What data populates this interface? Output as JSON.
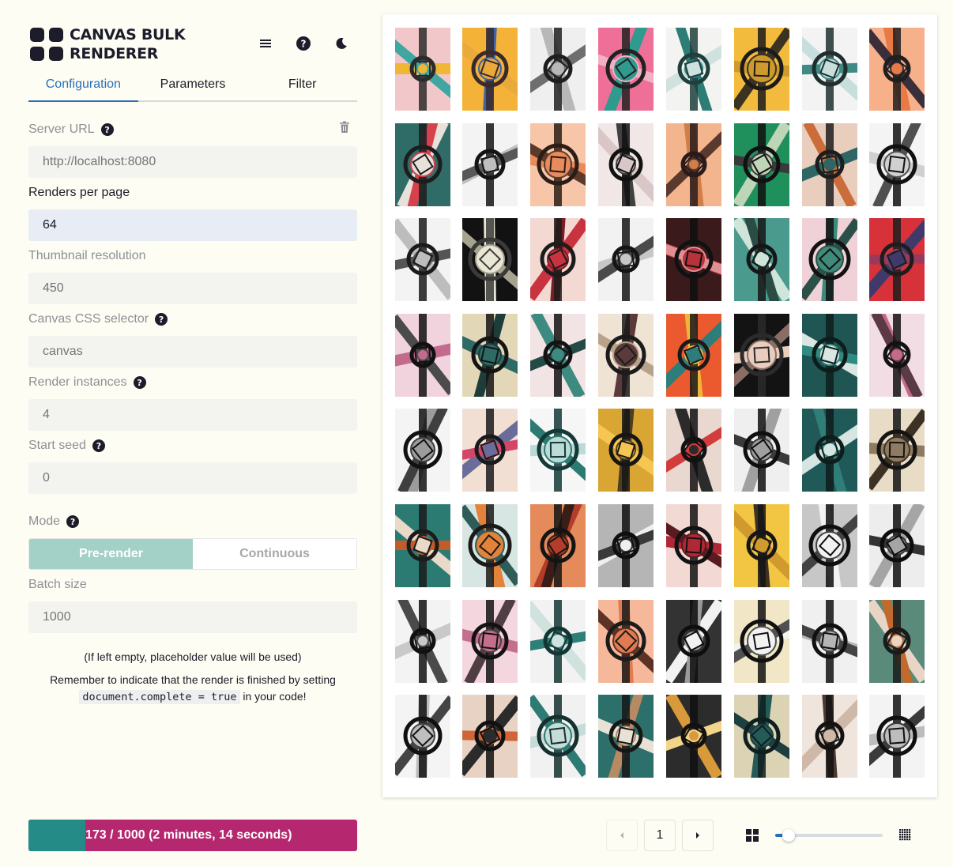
{
  "app": {
    "title_line1": "CANVAS BULK",
    "title_line2": "RENDERER",
    "header_icons": [
      "menu-icon",
      "help-icon",
      "dark-mode-icon"
    ]
  },
  "tabs": [
    {
      "label": "Configuration",
      "active": true
    },
    {
      "label": "Parameters",
      "active": false
    },
    {
      "label": "Filter",
      "active": false
    }
  ],
  "form": {
    "server_url": {
      "label": "Server URL",
      "placeholder": "http://localhost:8080",
      "value": ""
    },
    "renders_per_page": {
      "label": "Renders per page",
      "value": "64"
    },
    "thumbnail_resolution": {
      "label": "Thumbnail resolution",
      "placeholder": "450",
      "value": ""
    },
    "canvas_selector": {
      "label": "Canvas CSS selector",
      "placeholder": "canvas",
      "value": ""
    },
    "render_instances": {
      "label": "Render instances",
      "placeholder": "4",
      "value": ""
    },
    "start_seed": {
      "label": "Start seed",
      "placeholder": "0",
      "value": ""
    },
    "mode": {
      "label": "Mode",
      "options": [
        "Pre-render",
        "Continuous"
      ],
      "selected": "Pre-render"
    },
    "batch_size": {
      "label": "Batch size",
      "placeholder": "1000",
      "value": ""
    }
  },
  "notes": {
    "empty_note": "(If left empty, placeholder value will be used)",
    "remember_prefix": "Remember to indicate that the render is finished by setting",
    "code": "document.complete = true",
    "remember_suffix": " in your code!"
  },
  "progress": {
    "text": "173 / 1000 (2 minutes, 14 seconds)",
    "done": 173,
    "total": 1000,
    "colors": {
      "done": "#248b87",
      "remaining": "#b5286f"
    }
  },
  "pagination": {
    "page": "1",
    "prev_icon": "caret-left-icon",
    "next_icon": "caret-right-icon"
  },
  "grid_size": {
    "small_icon": "grid-large-icon",
    "large_icon": "grid-dense-icon",
    "level": 0.12
  },
  "gallery": {
    "columns": 8,
    "rows": 8,
    "palettes": [
      [
        "#f2c7c9",
        "#f0b637",
        "#3fa6a1",
        "#2b2b2b"
      ],
      [
        "#f4b338",
        "#e9a93b",
        "#3d63a8",
        "#3a2a2a"
      ],
      [
        "#efefef",
        "#b8b8b8",
        "#6e6e6e",
        "#1e1e1e"
      ],
      [
        "#ee6f98",
        "#2f9a8d",
        "#f3b0c4",
        "#222222"
      ],
      [
        "#f3f3f1",
        "#cfe2df",
        "#2c7d76",
        "#1f3f3d"
      ],
      [
        "#f2bb3d",
        "#cf9a2d",
        "#3b3322",
        "#1b1b1b"
      ],
      [
        "#f3f3f3",
        "#c8dedc",
        "#3f8a84",
        "#1f2f2f"
      ],
      [
        "#f6b08a",
        "#e87b45",
        "#3a2e3a",
        "#1f1f1f"
      ],
      [
        "#2f6c68",
        "#e7e1da",
        "#d6414e",
        "#1d1d1d"
      ],
      [
        "#f3f3f3",
        "#bfbfbf",
        "#585858",
        "#141414"
      ],
      [
        "#f7c5a8",
        "#e98b5d",
        "#5b3a2c",
        "#2a1d16"
      ],
      [
        "#f2e7e7",
        "#d9c6c6",
        "#404040",
        "#111111"
      ],
      [
        "#f3b58d",
        "#d07f49",
        "#5a3a2e",
        "#2a1b1b"
      ],
      [
        "#1f8f5c",
        "#bfd5b8",
        "#3a3a3a",
        "#111111"
      ],
      [
        "#e9cdbd",
        "#2e6665",
        "#ca6d3a",
        "#1d1d1d"
      ],
      [
        "#f4f4f4",
        "#d0d0d0",
        "#505050",
        "#111111"
      ],
      [
        "#f3f3f3",
        "#bdbdbd",
        "#555555",
        "#1a1a1a"
      ],
      [
        "#121212",
        "#e9e6d5",
        "#a6a48f",
        "#3a3a3a"
      ],
      [
        "#f4d9d2",
        "#c8333f",
        "#7a1e26",
        "#1c1c1c"
      ],
      [
        "#f2f2f2",
        "#c7c7c7",
        "#4a4a4a",
        "#151515"
      ],
      [
        "#3a1a1a",
        "#b7333c",
        "#e08f93",
        "#111111"
      ],
      [
        "#4a9b8d",
        "#cfe5da",
        "#2b4b45",
        "#161616"
      ],
      [
        "#f0d1d8",
        "#3f8a7a",
        "#2b5048",
        "#121212"
      ],
      [
        "#d7313a",
        "#3f3a6a",
        "#9a3a5a",
        "#1d1d1d"
      ],
      [
        "#f1d3de",
        "#c26b8c",
        "#4b4b4b",
        "#111111"
      ],
      [
        "#e2d8b8",
        "#2e6a66",
        "#1e3c3a",
        "#141414"
      ],
      [
        "#f2e4e4",
        "#3d8a80",
        "#244a46",
        "#121212"
      ],
      [
        "#efe3d3",
        "#5a3a3a",
        "#b8a28a",
        "#1b1b1b"
      ],
      [
        "#eb5a2e",
        "#2e7d7a",
        "#f2b33a",
        "#1a1a1a"
      ],
      [
        "#131313",
        "#e9cdbe",
        "#8a6e64",
        "#2b2b2b"
      ],
      [
        "#1f5552",
        "#d9e6e2",
        "#2f8a82",
        "#0e1d1c"
      ],
      [
        "#f1dde3",
        "#c46a88",
        "#5a3a44",
        "#121212"
      ],
      [
        "#f4f4f4",
        "#9c9c9c",
        "#3f3f3f",
        "#111111"
      ],
      [
        "#f2dfd3",
        "#6a6c9a",
        "#d4456a",
        "#1a1a1a"
      ],
      [
        "#f6f6f6",
        "#bcdad6",
        "#2b7b73",
        "#133a37"
      ],
      [
        "#d9a533",
        "#f5c652",
        "#4e3d20",
        "#161616"
      ],
      [
        "#e9d8cf",
        "#2b2b2b",
        "#d33c3c",
        "#121212"
      ],
      [
        "#efefef",
        "#a0a0a0",
        "#3a3a3a",
        "#0f0f0f"
      ],
      [
        "#1f5a58",
        "#d5e5e2",
        "#2f7f78",
        "#0f1c1c"
      ],
      [
        "#e9dcc7",
        "#8f7b5f",
        "#3c3123",
        "#141414"
      ],
      [
        "#2c7b73",
        "#e8d9c8",
        "#c45c2a",
        "#1b1b1b"
      ],
      [
        "#d7e6e2",
        "#e2823b",
        "#2f5c58",
        "#1a1a1a"
      ],
      [
        "#e58a5a",
        "#b13d2a",
        "#3a1d16",
        "#141414"
      ],
      [
        "#b5b5b5",
        "#efefef",
        "#3a3a3a",
        "#0f0f0f"
      ],
      [
        "#f3d9d3",
        "#b02835",
        "#5a1a1f",
        "#121212"
      ],
      [
        "#f2c542",
        "#d19a2d",
        "#3d3322",
        "#151515"
      ],
      [
        "#c7c7c7",
        "#f2f2f2",
        "#424242",
        "#0e0e0e"
      ],
      [
        "#ededed",
        "#a5a5a5",
        "#333333",
        "#0d0d0d"
      ],
      [
        "#f3f3f3",
        "#c9c9c9",
        "#4a4a4a",
        "#111111"
      ],
      [
        "#f4d6de",
        "#c46f8e",
        "#4f3e44",
        "#121212"
      ],
      [
        "#f2f2f2",
        "#cfe2de",
        "#2e7f78",
        "#123634"
      ],
      [
        "#f5b89a",
        "#e27a52",
        "#5d3226",
        "#1b1b1b"
      ],
      [
        "#333333",
        "#f2f2f2",
        "#9a9a9a",
        "#0e0e0e"
      ],
      [
        "#f1e6c6",
        "#f2f2f2",
        "#505050",
        "#111111"
      ],
      [
        "#f0f0f0",
        "#b5b5b5",
        "#444444",
        "#111111"
      ],
      [
        "#5a8a7a",
        "#e9d5c6",
        "#c06a2e",
        "#1a1a1a"
      ],
      [
        "#f4f4f4",
        "#bebebe",
        "#444444",
        "#111111"
      ],
      [
        "#e7d2c4",
        "#2b2b2b",
        "#d0653a",
        "#111111"
      ],
      [
        "#f1f1f1",
        "#c6dcd8",
        "#2e7b74",
        "#15302f"
      ],
      [
        "#2d6f6b",
        "#e8e1d6",
        "#b68a62",
        "#161616"
      ],
      [
        "#2c2c2c",
        "#d89a3a",
        "#f2d48a",
        "#111111"
      ],
      [
        "#dcd3b5",
        "#245a58",
        "#1d3f3e",
        "#0f1f1f"
      ],
      [
        "#efe5dc",
        "#cfb8a8",
        "#4a3a32",
        "#121212"
      ],
      [
        "#f3f3f3",
        "#bdbdbd",
        "#3a3a3a",
        "#101010"
      ]
    ]
  }
}
